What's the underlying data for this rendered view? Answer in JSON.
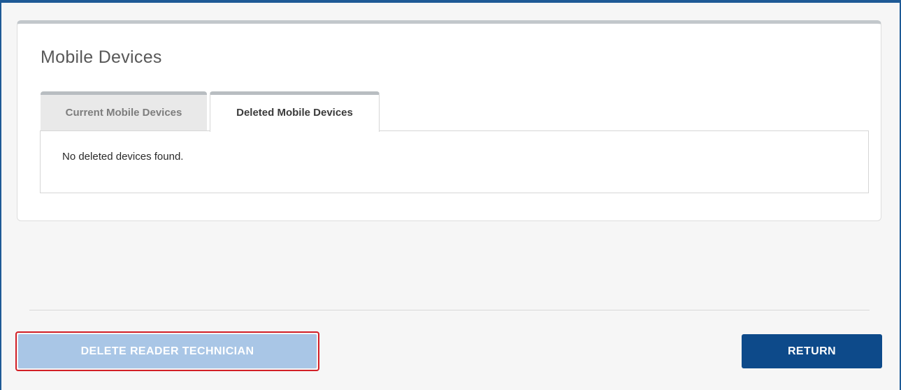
{
  "card": {
    "title": "Mobile Devices"
  },
  "tabs": {
    "current_label": "Current Mobile Devices",
    "deleted_label": "Deleted Mobile Devices",
    "active": "Deleted Mobile Devices"
  },
  "deleted_panel": {
    "empty_message": "No deleted devices found."
  },
  "actions": {
    "delete_label": "DELETE READER TECHNICIAN",
    "return_label": "RETURN"
  },
  "colors": {
    "frame": "#1e5a96",
    "primary_button": "#0d4a8a",
    "disabled_button": "#a9c6e6",
    "highlight_outline": "#d21f26"
  }
}
